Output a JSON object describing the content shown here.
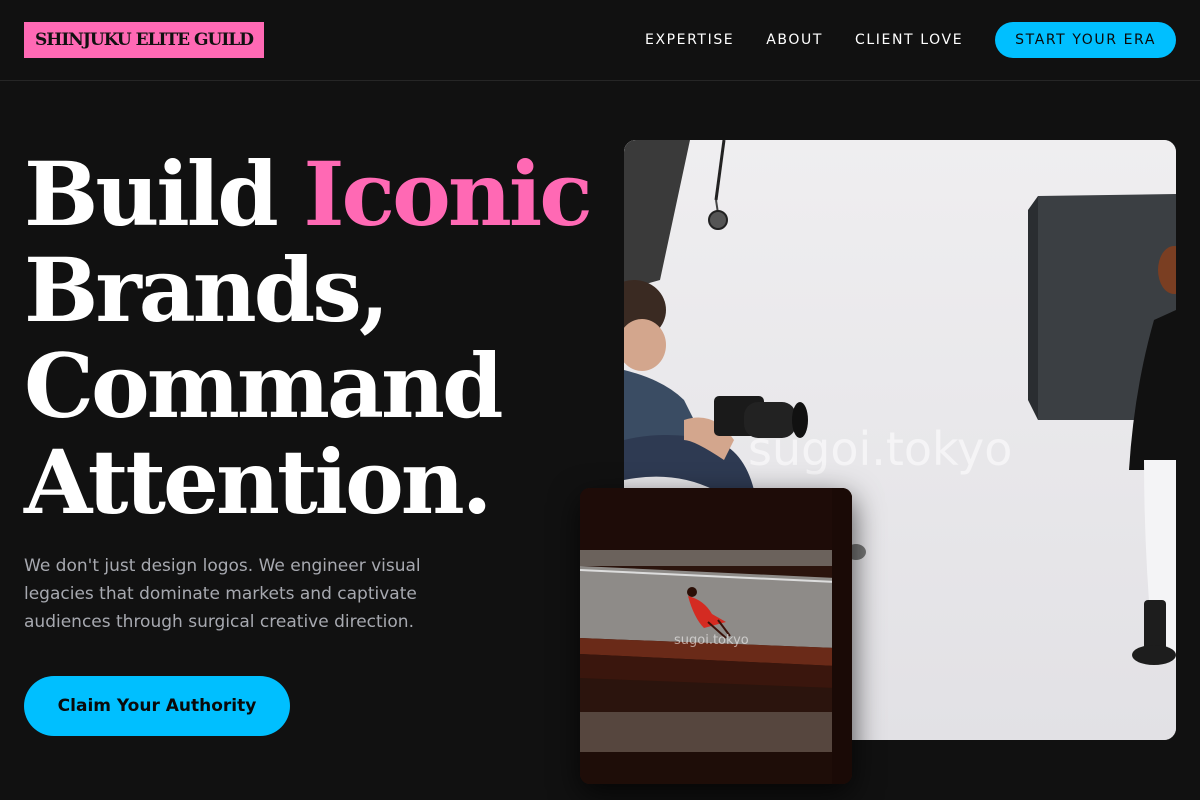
{
  "header": {
    "logo": "SHINJUKU ELITE GUILD",
    "nav": [
      "EXPERTISE",
      "ABOUT",
      "CLIENT LOVE"
    ],
    "cta": "START YOUR ERA"
  },
  "hero": {
    "headline_1": "Build ",
    "headline_accent": "Iconic",
    "headline_2": "Brands,",
    "headline_3": "Command",
    "headline_4": "Attention.",
    "subtext": "We don't just design logos. We engineer visual legacies that dominate markets and captivate audiences through surgical creative direction.",
    "cta": "Claim Your Authority"
  },
  "images": {
    "main_watermark": "sugoi.tokyo",
    "small_watermark": "sugoi.tokyo"
  },
  "colors": {
    "background": "#111111",
    "accent_pink": "#ff69b4",
    "accent_blue": "#00bfff",
    "muted_text": "#a7a9b0"
  }
}
